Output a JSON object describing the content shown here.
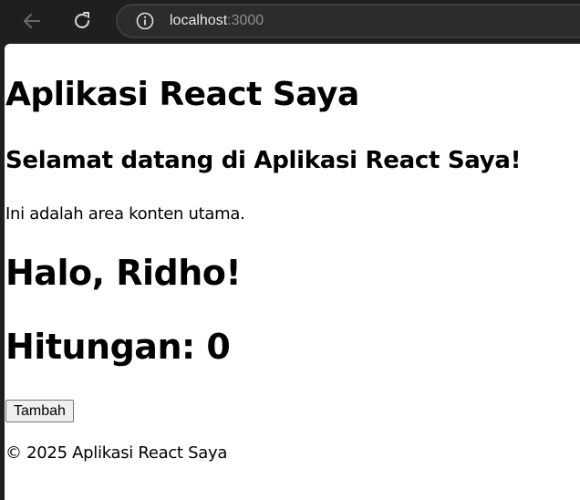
{
  "browser": {
    "url_host": "localhost",
    "url_port": ":3000",
    "icons": {
      "back": "back-arrow-icon",
      "reload": "reload-icon",
      "site_info": "info-icon"
    }
  },
  "page": {
    "title": "Aplikasi React Saya",
    "welcome": "Selamat datang di Aplikasi React Saya!",
    "content_text": "Ini adalah area konten utama.",
    "greeting": "Halo, Ridho!",
    "counter_text": "Hitungan: 0",
    "add_button_label": "Tambah",
    "footer_text": "© 2025 Aplikasi React Saya"
  }
}
